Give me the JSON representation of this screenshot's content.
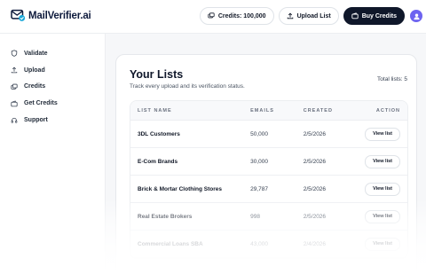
{
  "brand": {
    "name": "MailVerifier.ai",
    "accent": "#0f1b3d",
    "avatar_color": "#6d63f0"
  },
  "header": {
    "credits_label": "Credits: 100,000",
    "upload_label": "Upload List",
    "buy_label": "Buy Credits"
  },
  "sidebar": {
    "items": [
      {
        "label": "Validate",
        "icon": "shield-icon"
      },
      {
        "label": "Upload",
        "icon": "upload-icon"
      },
      {
        "label": "Credits",
        "icon": "credits-icon"
      },
      {
        "label": "Get Credits",
        "icon": "wallet-icon"
      },
      {
        "label": "Support",
        "icon": "headset-icon"
      }
    ]
  },
  "main": {
    "title": "Your Lists",
    "subtitle": "Track every upload and its verification status.",
    "total": "Total lists: 5",
    "table": {
      "headers": {
        "name": "LIST NAME",
        "emails": "EMAILS",
        "created": "CREATED",
        "action": "ACTION"
      },
      "rows": [
        {
          "name": "3DL Customers",
          "emails": "50,000",
          "created": "2/5/2026",
          "action": "View list"
        },
        {
          "name": "E-Com Brands",
          "emails": "30,000",
          "created": "2/5/2026",
          "action": "View list"
        },
        {
          "name": "Brick & Mortar Clothing Stores",
          "emails": "29,787",
          "created": "2/5/2026",
          "action": "View list"
        },
        {
          "name": "Real Estate Brokers",
          "emails": "998",
          "created": "2/5/2026",
          "action": "View list"
        },
        {
          "name": "Commercial Loans SBA",
          "emails": "43,000",
          "created": "2/4/2026",
          "action": "View list"
        }
      ]
    }
  }
}
